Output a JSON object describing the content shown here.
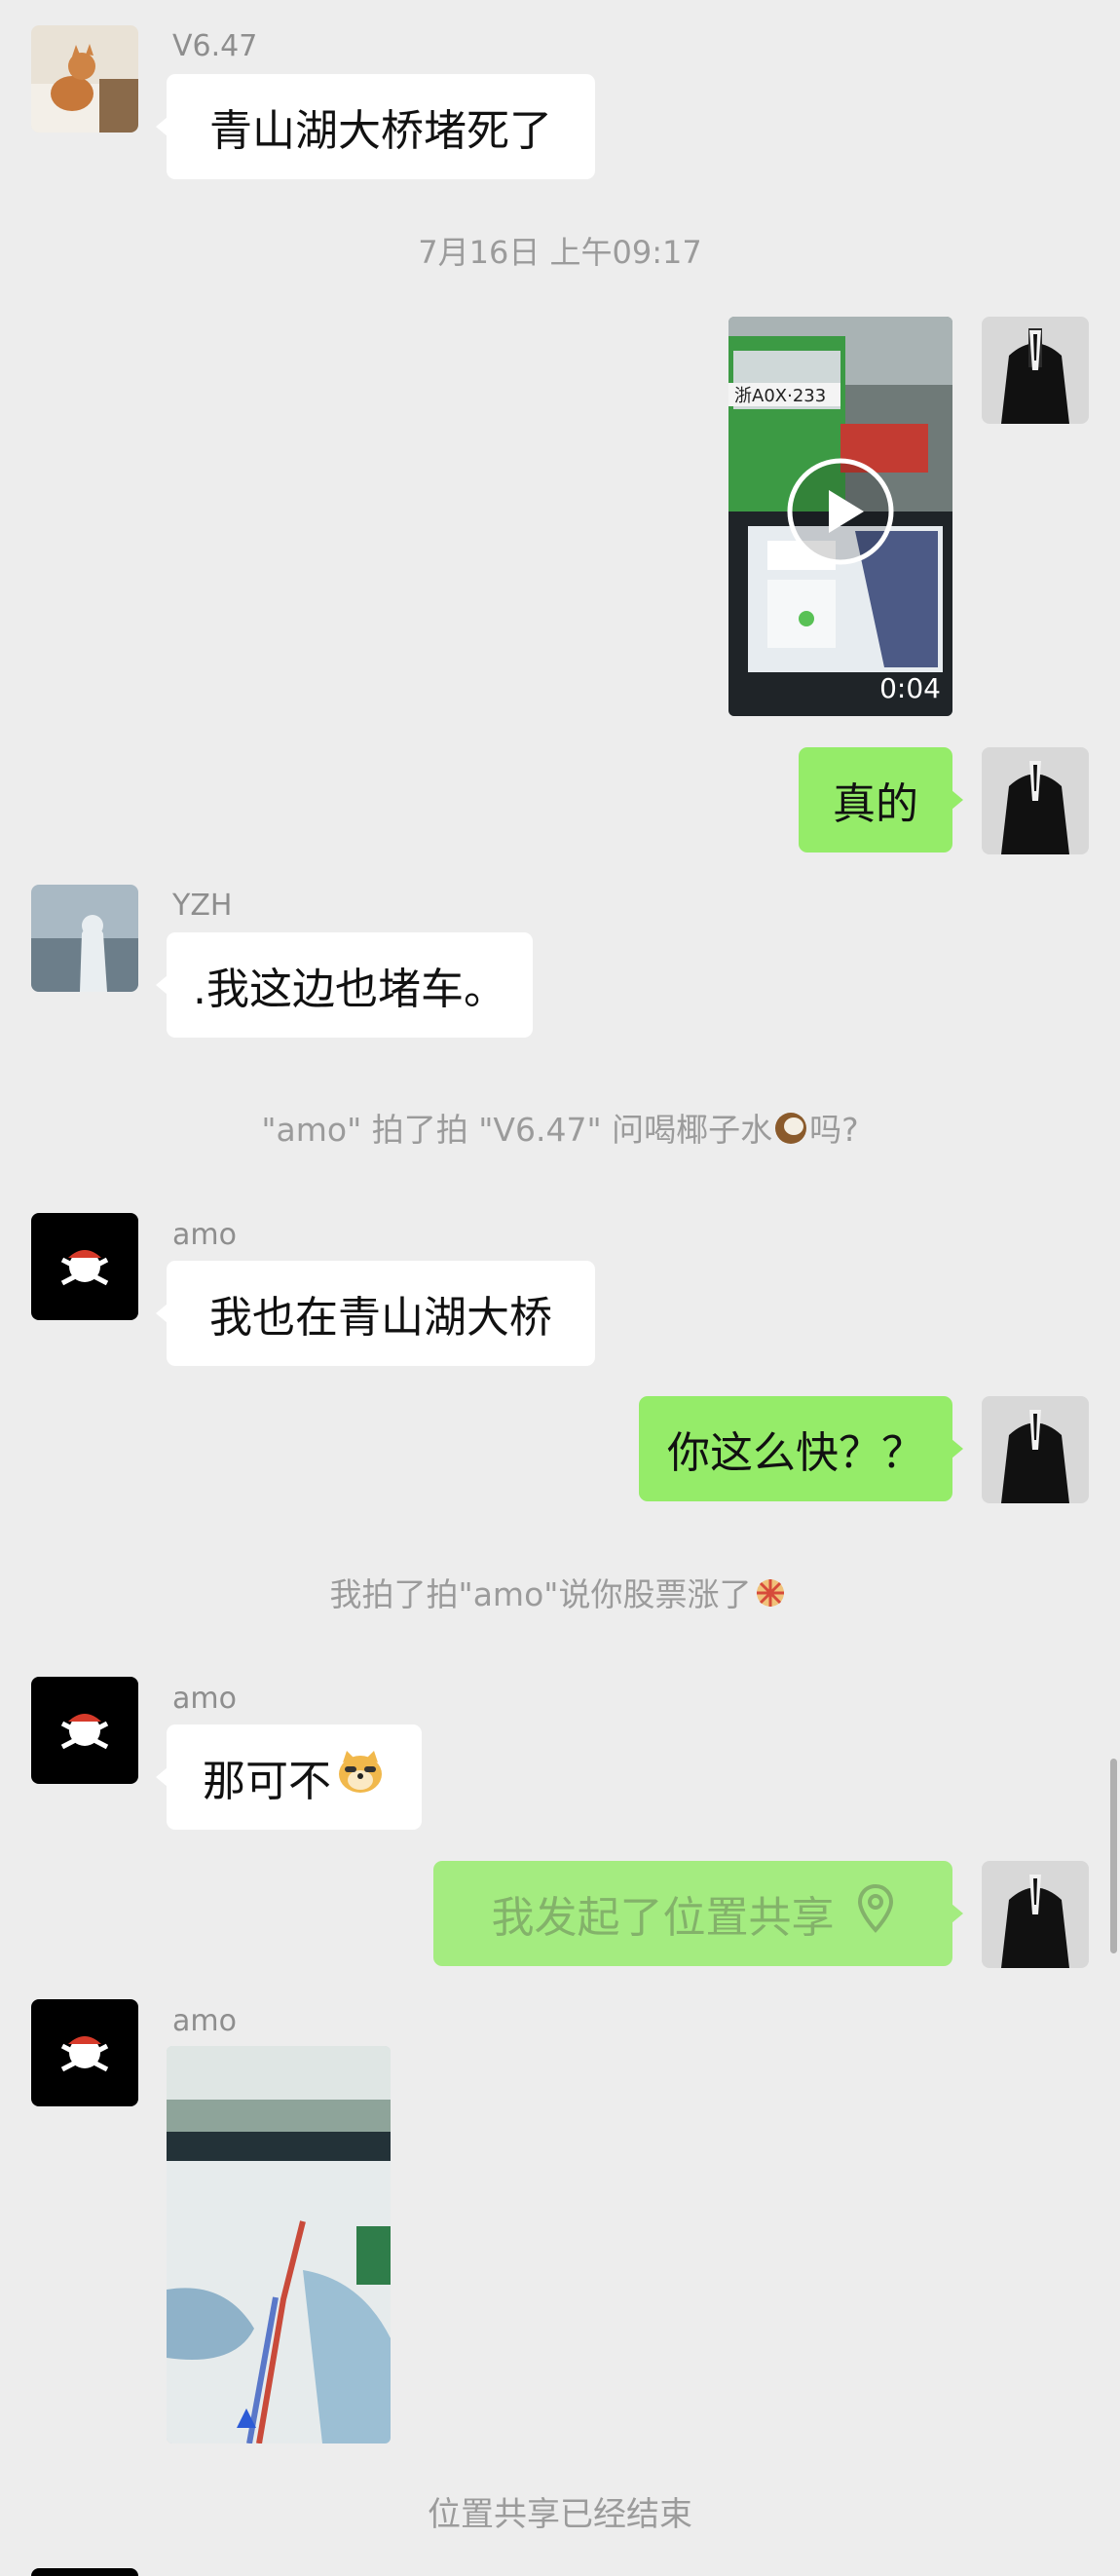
{
  "messages": {
    "m1": {
      "sender": "V6.47",
      "text": "青山湖大桥堵死了"
    },
    "timestamp": "7月16日 上午09:17",
    "m2": {
      "duration": "0:04",
      "plate": "浙A0X·233"
    },
    "m3": {
      "text": "真的"
    },
    "m4": {
      "sender": "YZH",
      "text": ".我这边也堵车。"
    },
    "pat1": {
      "text": "\"amo\" 拍了拍 \"V6.47\" 问喝椰子水",
      "suffix": "吗?"
    },
    "m5": {
      "sender": "amo",
      "text": "我也在青山湖大桥"
    },
    "m6": {
      "text": "你这么快？？"
    },
    "pat2": {
      "text": "我拍了拍\"amo\"说你股票涨了"
    },
    "m7": {
      "sender": "amo",
      "text": "那可不"
    },
    "m8": {
      "text": "我发起了位置共享"
    },
    "m9": {
      "sender": "amo"
    },
    "end": {
      "text": "位置共享已经结束"
    }
  },
  "colors": {
    "background": "#ededed",
    "sent_bubble": "#95ec69",
    "received_bubble": "#ffffff",
    "system_text": "#9b9b9b"
  }
}
